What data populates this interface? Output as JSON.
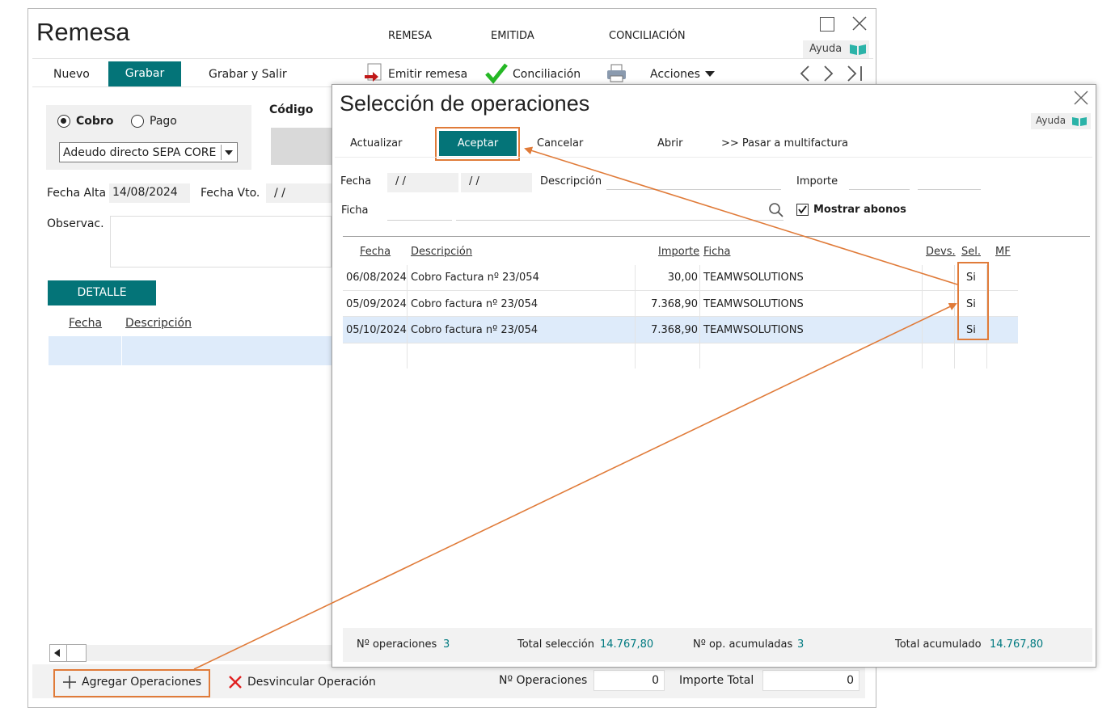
{
  "main": {
    "title": "Remesa",
    "status_tabs": [
      "REMESA",
      "EMITIDA",
      "CONCILIACIÓN"
    ],
    "help_label": "Ayuda",
    "toolbar": {
      "nuevo": "Nuevo",
      "grabar": "Grabar",
      "grabar_salir": "Grabar y Salir",
      "emitir": "Emitir remesa",
      "conciliacion": "Conciliación",
      "acciones": "Acciones"
    },
    "form": {
      "cobro": "Cobro",
      "pago": "Pago",
      "codigo_label": "Código",
      "tipo_value": "Adeudo directo SEPA CORE",
      "fecha_alta_label": "Fecha Alta",
      "fecha_alta_value": "14/08/2024",
      "fecha_vto_label": "Fecha Vto.",
      "fecha_vto_value": "/ /",
      "observ_label": "Observac."
    },
    "detalle": {
      "tab_label": "DETALLE",
      "col_fecha": "Fecha",
      "col_descripcion": "Descripción"
    },
    "bottom": {
      "agregar": "Agregar Operaciones",
      "desvincular": "Desvincular Operación",
      "n_operaciones_label": "Nº Operaciones",
      "n_operaciones_value": "0",
      "importe_total_label": "Importe Total",
      "importe_total_value": "0"
    }
  },
  "dialog": {
    "title": "Selección de operaciones",
    "help_label": "Ayuda",
    "toolbar": {
      "actualizar": "Actualizar",
      "aceptar": "Aceptar",
      "cancelar": "Cancelar",
      "abrir": "Abrir",
      "multifactura": ">> Pasar a multifactura"
    },
    "filters": {
      "fecha_label": "Fecha",
      "fecha_from": "/ /",
      "fecha_to": "/ /",
      "descripcion_label": "Descripción",
      "importe_label": "Importe",
      "ficha_label": "Ficha",
      "mostrar_abonos": "Mostrar abonos"
    },
    "columns": {
      "fecha": "Fecha",
      "descripcion": "Descripción",
      "importe": "Importe",
      "ficha": "Ficha",
      "devs": "Devs.",
      "sel": "Sel.",
      "mf": "MF"
    },
    "rows": [
      {
        "fecha": "06/08/2024",
        "descripcion": "Cobro Factura nº 23/054",
        "importe": "30,00",
        "ficha": "TEAMWSOLUTIONS",
        "sel": "Si"
      },
      {
        "fecha": "05/09/2024",
        "descripcion": "Cobro factura nº 23/054",
        "importe": "7.368,90",
        "ficha": "TEAMWSOLUTIONS",
        "sel": "Si"
      },
      {
        "fecha": "05/10/2024",
        "descripcion": "Cobro factura nº 23/054",
        "importe": "7.368,90",
        "ficha": "TEAMWSOLUTIONS",
        "sel": "Si"
      }
    ],
    "footer": {
      "n_operaciones_label": "Nº operaciones",
      "n_operaciones_value": "3",
      "total_seleccion_label": "Total selección",
      "total_seleccion_value": "14.767,80",
      "n_op_acumuladas_label": "Nº op. acumuladas",
      "n_op_acumuladas_value": "3",
      "total_acumulado_label": "Total acumulado",
      "total_acumulado_value": "14.767,80"
    }
  },
  "colors": {
    "teal": "#047478",
    "annotation": "#e07b39",
    "selected_row": "#deebfa"
  }
}
